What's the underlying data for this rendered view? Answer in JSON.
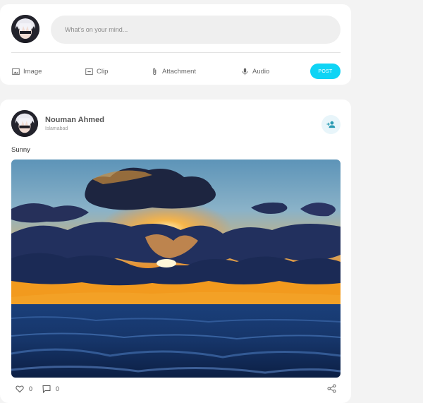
{
  "composer": {
    "placeholder": "What's on your mind...",
    "actions": [
      {
        "label": "Image",
        "icon": "image-icon"
      },
      {
        "label": "Clip",
        "icon": "clip-icon"
      },
      {
        "label": "Attachment",
        "icon": "paperclip-icon"
      },
      {
        "label": "Audio",
        "icon": "microphone-icon"
      }
    ],
    "post_label": "POST",
    "post_color": "#0fd4f5"
  },
  "post": {
    "author": "Nouman Ahmed",
    "location": "Islamabad",
    "text": "Sunny",
    "likes": "0",
    "comments": "0"
  }
}
